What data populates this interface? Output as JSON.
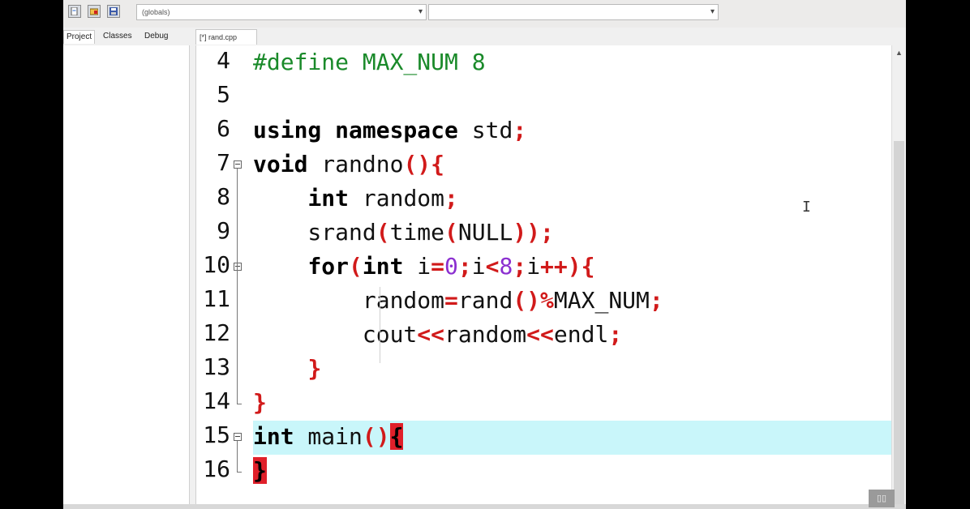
{
  "toolbar": {
    "icons": [
      "new-file-icon",
      "open-file-icon",
      "save-icon"
    ],
    "scope_combo": "(globals)",
    "member_combo": ""
  },
  "panel_tabs": [
    "Project",
    "Classes",
    "Debug"
  ],
  "file_tab": "[*] rand.cpp",
  "editor": {
    "lines": [
      {
        "num": "4",
        "segments": [
          {
            "t": "#define MAX_NUM 8",
            "c": "pre"
          }
        ]
      },
      {
        "num": "5",
        "segments": []
      },
      {
        "num": "6",
        "segments": [
          {
            "t": "using namespace",
            "c": "kw"
          },
          {
            "t": " std",
            "c": ""
          },
          {
            "t": ";",
            "c": "sym"
          }
        ]
      },
      {
        "num": "7",
        "segments": [
          {
            "t": "void",
            "c": "kw"
          },
          {
            "t": " randno",
            "c": ""
          },
          {
            "t": "(){",
            "c": "sym"
          }
        ]
      },
      {
        "num": "8",
        "segments": [
          {
            "t": "    ",
            "c": ""
          },
          {
            "t": "int",
            "c": "kw"
          },
          {
            "t": " random",
            "c": ""
          },
          {
            "t": ";",
            "c": "sym"
          }
        ]
      },
      {
        "num": "9",
        "segments": [
          {
            "t": "    srand",
            "c": ""
          },
          {
            "t": "(",
            "c": "sym"
          },
          {
            "t": "time",
            "c": ""
          },
          {
            "t": "(",
            "c": "sym"
          },
          {
            "t": "NULL",
            "c": ""
          },
          {
            "t": "));",
            "c": "sym"
          }
        ]
      },
      {
        "num": "10",
        "segments": [
          {
            "t": "    ",
            "c": ""
          },
          {
            "t": "for",
            "c": "kw"
          },
          {
            "t": "(",
            "c": "sym"
          },
          {
            "t": "int",
            "c": "kw"
          },
          {
            "t": " i",
            "c": ""
          },
          {
            "t": "=",
            "c": "sym"
          },
          {
            "t": "0",
            "c": "num"
          },
          {
            "t": ";",
            "c": "sym"
          },
          {
            "t": "i",
            "c": ""
          },
          {
            "t": "<",
            "c": "sym"
          },
          {
            "t": "8",
            "c": "num"
          },
          {
            "t": ";",
            "c": "sym"
          },
          {
            "t": "i",
            "c": ""
          },
          {
            "t": "++){",
            "c": "sym"
          }
        ]
      },
      {
        "num": "11",
        "segments": [
          {
            "t": "        random",
            "c": ""
          },
          {
            "t": "=",
            "c": "sym"
          },
          {
            "t": "rand",
            "c": ""
          },
          {
            "t": "()%",
            "c": "sym"
          },
          {
            "t": "MAX_NUM",
            "c": ""
          },
          {
            "t": ";",
            "c": "sym"
          }
        ]
      },
      {
        "num": "12",
        "segments": [
          {
            "t": "        cout",
            "c": ""
          },
          {
            "t": "<<",
            "c": "sym"
          },
          {
            "t": "random",
            "c": ""
          },
          {
            "t": "<<",
            "c": "sym"
          },
          {
            "t": "endl",
            "c": ""
          },
          {
            "t": ";",
            "c": "sym"
          }
        ]
      },
      {
        "num": "13",
        "segments": [
          {
            "t": "    ",
            "c": ""
          },
          {
            "t": "}",
            "c": "sym"
          }
        ]
      },
      {
        "num": "14",
        "segments": [
          {
            "t": "}",
            "c": "sym"
          }
        ]
      },
      {
        "num": "15",
        "segments": [
          {
            "t": "int",
            "c": "kw"
          },
          {
            "t": " main",
            "c": ""
          },
          {
            "t": "()",
            "c": "sym"
          },
          {
            "t": "{",
            "c": "bracehl"
          }
        ]
      },
      {
        "num": "16",
        "segments": [
          {
            "t": "}",
            "c": "bracehl"
          }
        ]
      }
    ]
  },
  "colors": {
    "preprocessor": "#1a8a2a",
    "symbol": "#d11a1a",
    "number": "#8b2fd0",
    "current_line": "#c9f6fa",
    "brace_match": "#e0202a"
  }
}
